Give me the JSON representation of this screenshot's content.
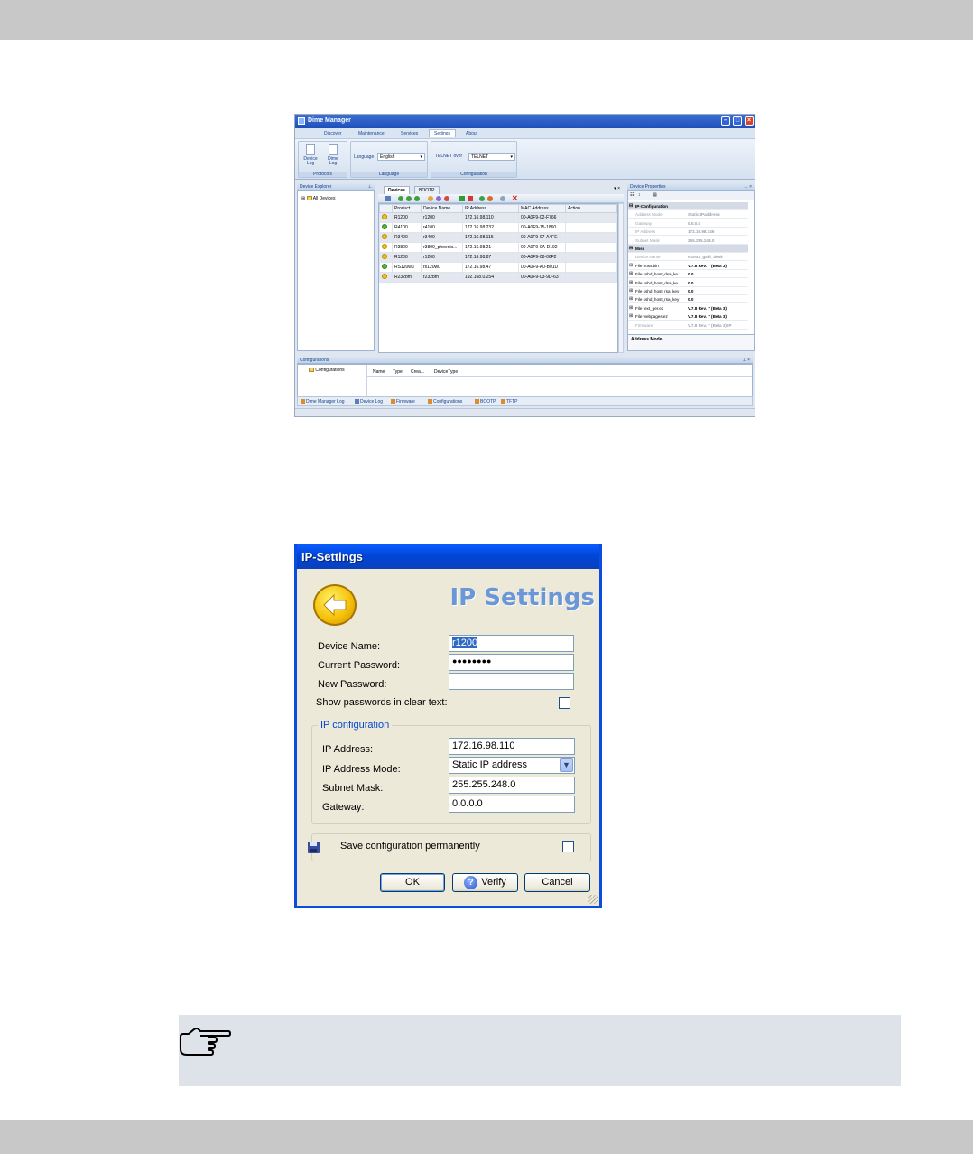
{
  "dime": {
    "title": "Dime Manager",
    "menu": [
      "Discover",
      "Maintenance",
      "Services",
      "Settings",
      "About"
    ],
    "active_menu": "Settings",
    "ribbon": {
      "device_log": "Device Log",
      "dime_log": "Dime Log",
      "protocols": "Protocols",
      "language_label": "Language",
      "language_value": "English",
      "language_group": "Language",
      "telnet_label": "TELNET over",
      "telnet_value": "TELNET",
      "configuration_group": "Configuration"
    },
    "explorer": {
      "title": "Device Explorer",
      "root": "All Devices"
    },
    "tabs": [
      "Devices",
      "BOOTP"
    ],
    "grid": {
      "columns": [
        "Product",
        "Device Name",
        "IP Address",
        "MAC Address",
        "Action"
      ],
      "rows": [
        {
          "status": "yellow",
          "product": "R1200",
          "name": "r1200",
          "ip": "172.16.98.110",
          "mac": "00-A0F9-02-F766"
        },
        {
          "status": "green",
          "product": "R4100",
          "name": "r4100",
          "ip": "172.16.98.232",
          "mac": "00-A0F9-15-1860"
        },
        {
          "status": "yellow",
          "product": "R3400",
          "name": "r3400",
          "ip": "172.16.98.115",
          "mac": "00-A0F9-07-A4FE"
        },
        {
          "status": "yellow",
          "product": "R3800",
          "name": "r3800_phoenix...",
          "ip": "172.16.98.21",
          "mac": "00-A0F9-0A-D192"
        },
        {
          "status": "yellow",
          "product": "R1200",
          "name": "r1200",
          "ip": "172.16.98.87",
          "mac": "00-A0F9-08-06F2"
        },
        {
          "status": "green",
          "product": "RS120wu",
          "name": "rs120wu",
          "ip": "172.16.98.47",
          "mac": "00-A0F9-A0-B01D"
        },
        {
          "status": "yellow",
          "product": "R232bm",
          "name": "r232bm",
          "ip": "192.168.0.254",
          "mac": "00-A0F9-03-9D-63"
        }
      ]
    },
    "properties": {
      "title": "Device Properties",
      "rows": [
        {
          "kind": "cat",
          "k": "IP-Configuration",
          "v": ""
        },
        {
          "kind": "grey",
          "k": "Address Mode",
          "v": "Static IPaddress"
        },
        {
          "kind": "grey",
          "k": "Gateway",
          "v": "0.0.0.0"
        },
        {
          "kind": "grey",
          "k": "IP Address",
          "v": "172.16.98.146"
        },
        {
          "kind": "grey",
          "k": "Subnet Mask",
          "v": "255.255.248.0"
        },
        {
          "kind": "cat",
          "k": "Misc",
          "v": ""
        },
        {
          "kind": "grey",
          "k": "Device Name",
          "v": "w1002_gabi_desk"
        },
        {
          "kind": "plus",
          "k": "File boss.bin",
          "v": "V.7.8 Rev. 7 (Beta 3)"
        },
        {
          "kind": "plus",
          "k": "File sshd_host_dsa_ke",
          "v": "0.0"
        },
        {
          "kind": "plus",
          "k": "File sshd_host_dsa_ke",
          "v": "0.0"
        },
        {
          "kind": "plus",
          "k": "File sshd_host_rsa_key",
          "v": "0.0"
        },
        {
          "kind": "plus",
          "k": "File sshd_host_rsa_key",
          "v": "0.0"
        },
        {
          "kind": "plus",
          "k": "File text_ger.ez",
          "v": "V.7.8 Rev. 7 (Beta 3)"
        },
        {
          "kind": "plus",
          "k": "File webpages.ez",
          "v": "V.7.8 Rev. 7 (Beta 3)"
        },
        {
          "kind": "grey",
          "k": "Firmware",
          "v": "V.7.8 Rev. 7 (Beta 3) IP"
        }
      ],
      "description": "Address Mode"
    },
    "configurations": {
      "title": "Configurations",
      "tree_item": "Configurations",
      "columns": [
        "Name",
        "Type",
        "Crea...",
        "DeviceType"
      ]
    },
    "bottom_tabs": [
      "Dime Manager Log",
      "Device Log",
      "Firmware",
      "Configurations",
      "BOOTP",
      "TFTP"
    ]
  },
  "ip_dialog": {
    "title": "IP-Settings",
    "heading": "IP Settings",
    "device_name_label": "Device Name:",
    "device_name_value": "r1200",
    "current_password_label": "Current Password:",
    "current_password_value": "●●●●●●●●",
    "new_password_label": "New Password:",
    "new_password_value": "",
    "show_passwords_label": "Show passwords in clear text:",
    "ip_config_legend": "IP configuration",
    "ip_address_label": "IP Address:",
    "ip_address_value": "172.16.98.110",
    "ip_mode_label": "IP Address  Mode:",
    "ip_mode_value": "Static IP address",
    "subnet_label": "Subnet Mask:",
    "subnet_value": "255.255.248.0",
    "gateway_label": "Gateway:",
    "gateway_value": "0.0.0.0",
    "save_label": "Save configuration permanently",
    "ok_label": "OK",
    "verify_label": "Verify",
    "cancel_label": "Cancel"
  },
  "colors": {
    "band": "#c8c8c8",
    "note_bg": "#dde3e9",
    "xp_title": "#0046d6",
    "heading": "#6b97d8"
  }
}
